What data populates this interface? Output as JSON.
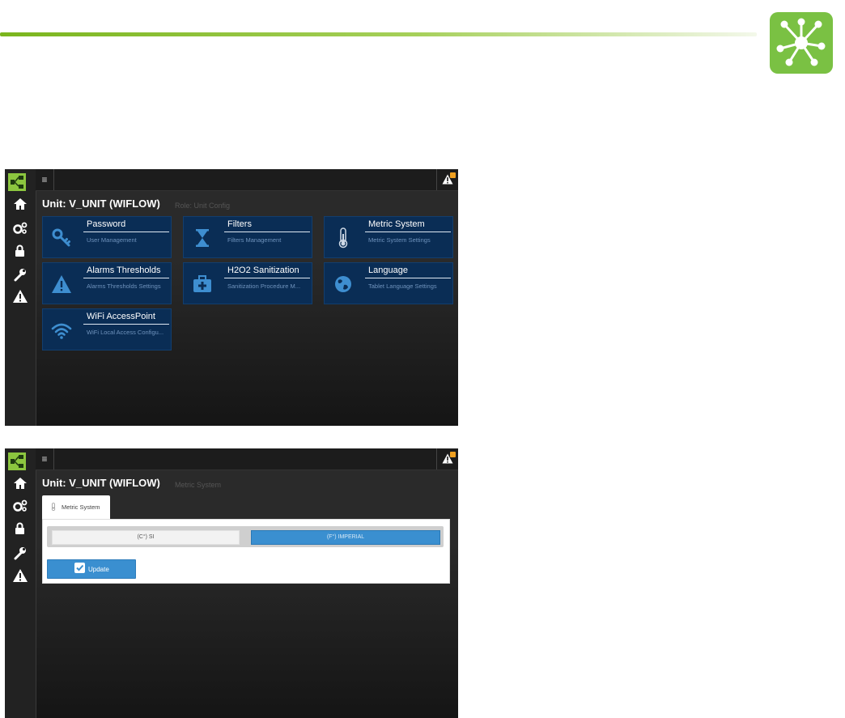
{
  "screen1": {
    "unit_title": "Unit: V_UNIT (WIFLOW)",
    "unit_subtitle": "Role: Unit Config",
    "tiles": [
      {
        "title": "Password",
        "subtitle": "User Management",
        "icon": "key-icon"
      },
      {
        "title": "Filters",
        "subtitle": "Filters Management",
        "icon": "hourglass-icon"
      },
      {
        "title": "Metric System",
        "subtitle": "Metric System Settings",
        "icon": "thermometer-icon"
      },
      {
        "title": "Alarms Thresholds",
        "subtitle": "Alarms Thresholds Settings",
        "icon": "warning-icon"
      },
      {
        "title": "H2O2 Sanitization",
        "subtitle": "Sanitization Procedure M...",
        "icon": "first-aid-icon"
      },
      {
        "title": "Language",
        "subtitle": "Tablet Language Settings",
        "icon": "globe-icon"
      },
      {
        "title": "WiFi AccessPoint",
        "subtitle": "WiFi Local Access Configu...",
        "icon": "wifi-icon"
      }
    ]
  },
  "screen2": {
    "unit_title": "Unit: V_UNIT (WIFLOW)",
    "unit_subtitle": "Metric System",
    "tab_label": "Metric System",
    "option_si": "(C°) SI",
    "option_imperial": "(F°) IMPERIAL",
    "selected_option": "imperial",
    "update_label": "Update"
  },
  "colors": {
    "brand_green": "#7ac143",
    "tile_blue": "#0a2d55",
    "accent_blue": "#3a8fd0",
    "alert_badge": "#f0a020"
  }
}
